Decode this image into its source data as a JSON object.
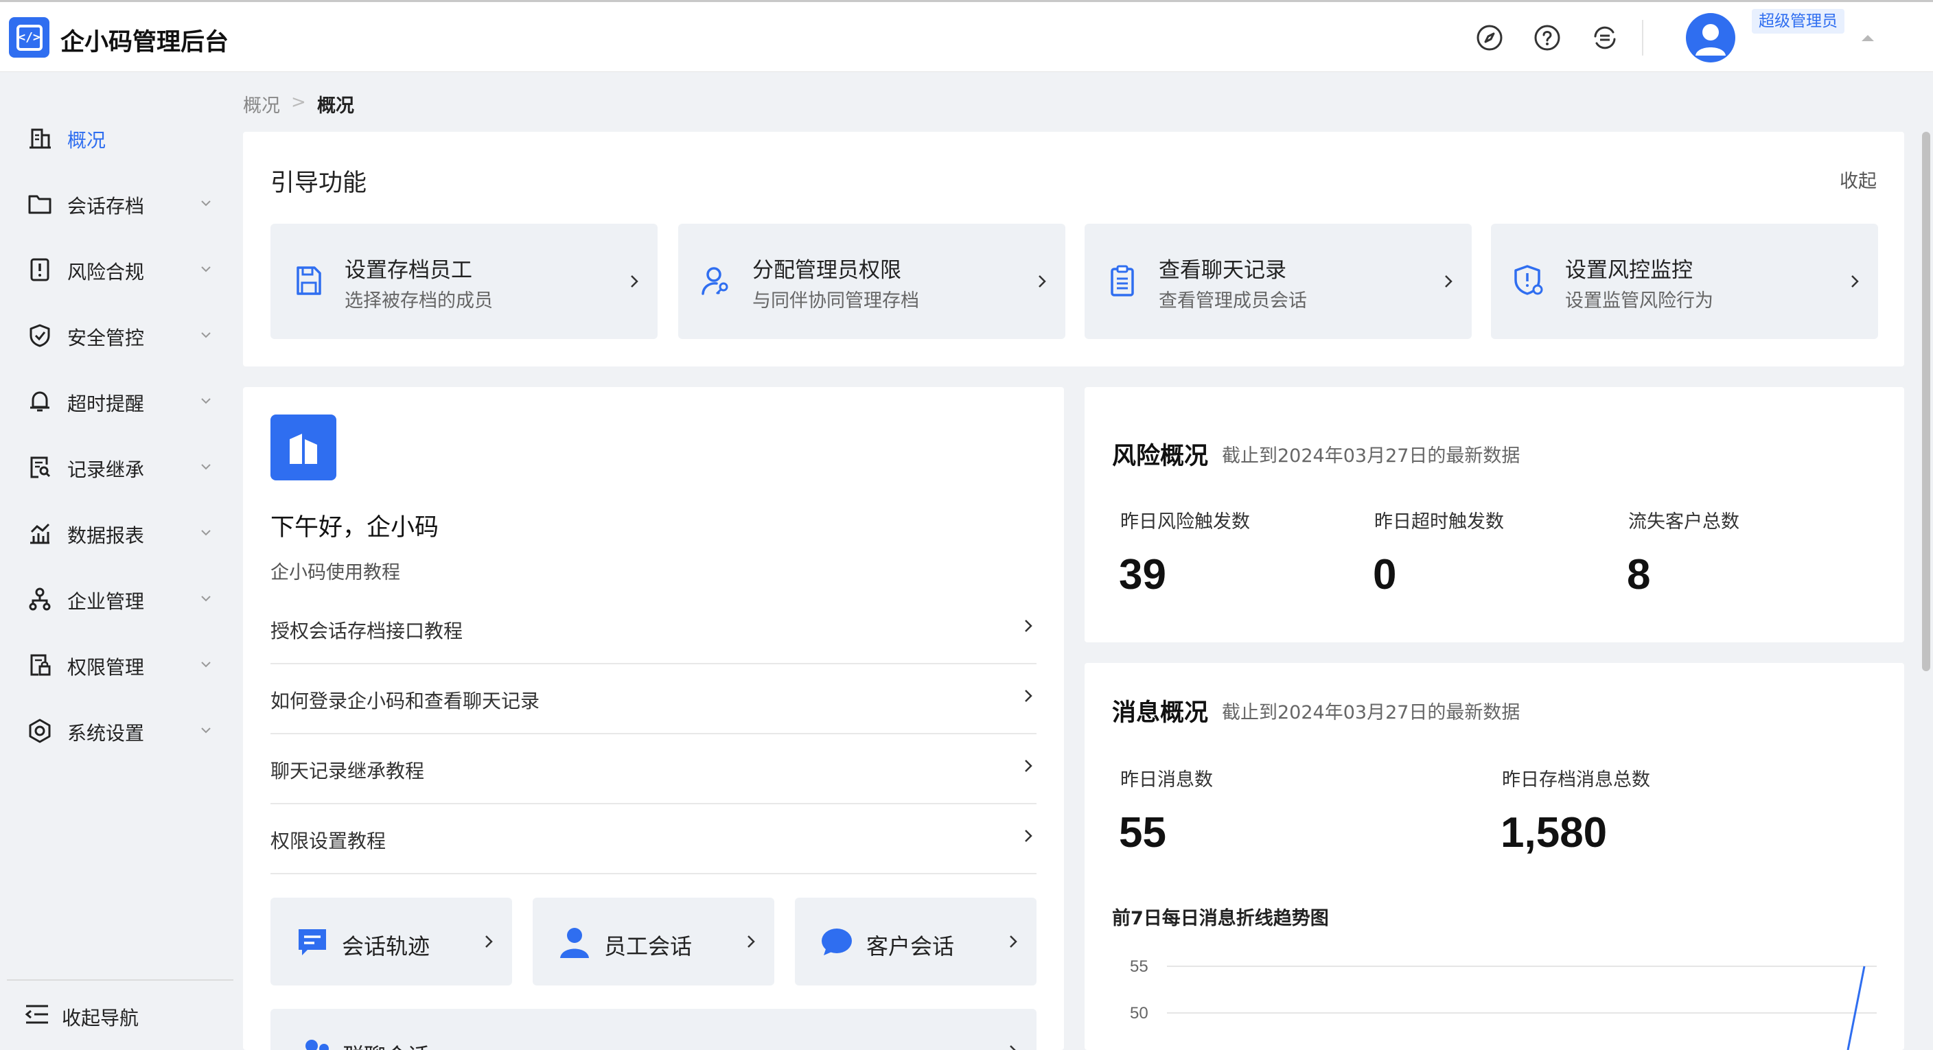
{
  "app": {
    "title": "企小码管理后台",
    "logo_glyph": "</>"
  },
  "header": {
    "role_badge": "超级管理员",
    "icons": [
      "compass-icon",
      "help-icon",
      "switch-icon"
    ]
  },
  "sidebar": {
    "items": [
      {
        "label": "概况",
        "icon": "building-icon",
        "active": true
      },
      {
        "label": "会话存档",
        "icon": "folder-icon"
      },
      {
        "label": "风险合规",
        "icon": "alert-icon"
      },
      {
        "label": "安全管控",
        "icon": "shield-check-icon"
      },
      {
        "label": "超时提醒",
        "icon": "bell-icon"
      },
      {
        "label": "记录继承",
        "icon": "document-search-icon"
      },
      {
        "label": "数据报表",
        "icon": "chart-icon"
      },
      {
        "label": "企业管理",
        "icon": "org-icon"
      },
      {
        "label": "权限管理",
        "icon": "lock-doc-icon"
      },
      {
        "label": "系统设置",
        "icon": "settings-icon"
      }
    ],
    "collapse_label": "收起导航"
  },
  "breadcrumb": {
    "parent": "概况",
    "sep": ">",
    "current": "概况"
  },
  "guide": {
    "title": "引导功能",
    "collapse": "收起",
    "items": [
      {
        "title": "设置存档员工",
        "sub": "选择被存档的成员",
        "icon": "save-icon"
      },
      {
        "title": "分配管理员权限",
        "sub": "与同伴协同管理存档",
        "icon": "user-key-icon"
      },
      {
        "title": "查看聊天记录",
        "sub": "查看管理成员会话",
        "icon": "clipboard-icon"
      },
      {
        "title": "设置风控监控",
        "sub": "设置监管风险行为",
        "icon": "shield-alert-icon"
      }
    ]
  },
  "welcome": {
    "greeting": "下午好，企小码",
    "tutorial_title": "企小码使用教程",
    "tutorials": [
      "授权会话存档接口教程",
      "如何登录企小码和查看聊天记录",
      "聊天记录继承教程",
      "权限设置教程"
    ],
    "quick": [
      {
        "label": "会话轨迹",
        "icon": "chat-track-icon"
      },
      {
        "label": "员工会话",
        "icon": "person-icon"
      },
      {
        "label": "客户会话",
        "icon": "message-bubble-icon"
      }
    ],
    "quick_wide": {
      "label": "群聊会话",
      "icon": "group-icon"
    }
  },
  "risk": {
    "title": "风险概况",
    "sub": "截止到2024年03月27日的最新数据",
    "stats": [
      {
        "label": "昨日风险触发数",
        "value": "39"
      },
      {
        "label": "昨日超时触发数",
        "value": "0"
      },
      {
        "label": "流失客户总数",
        "value": "8"
      }
    ]
  },
  "messages": {
    "title": "消息概况",
    "sub": "截止到2024年03月27日的最新数据",
    "stats": [
      {
        "label": "昨日消息数",
        "value": "55"
      },
      {
        "label": "昨日存档消息总数",
        "value": "1,580"
      }
    ],
    "trend_title": "前7日每日消息折线趋势图"
  },
  "chart_data": {
    "type": "line",
    "title": "前7日每日消息折线趋势图",
    "y_ticks": [
      "55",
      "50"
    ],
    "visible_segment": {
      "y_end": 55
    },
    "accent": "#2f6ef0"
  },
  "colors": {
    "accent": "#2f6ef0",
    "bg": "#f0f2f5"
  }
}
